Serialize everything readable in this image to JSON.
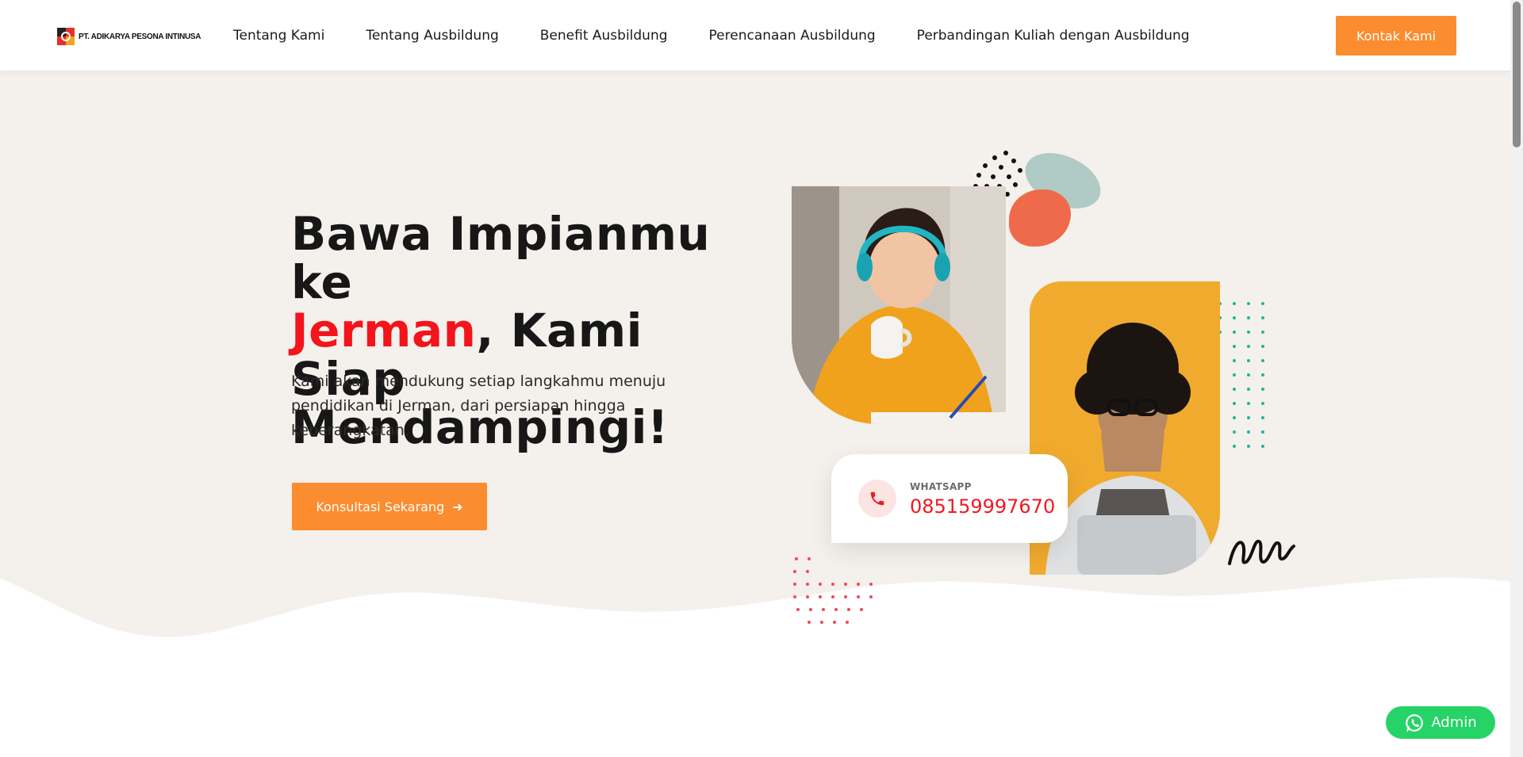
{
  "header": {
    "logo_text": "PT. ADIKARYA PESONA INTINUSA",
    "nav": [
      {
        "label": "Tentang Kami"
      },
      {
        "label": "Tentang Ausbildung"
      },
      {
        "label": "Benefit Ausbildung"
      },
      {
        "label": "Perencanaan Ausbildung"
      },
      {
        "label": "Perbandingan Kuliah dengan Ausbildung"
      }
    ],
    "contact_button": "Kontak Kami"
  },
  "hero": {
    "headline_part1": "Bawa Impianmu ke",
    "headline_highlight": "Jerman",
    "headline_part2": ", Kami Siap Mendampingi!",
    "subtext": "Kami akan mendukung setiap langkahmu menuju pendidikan di Jerman, dari persiapan hingga keberangkatan.",
    "cta_button": "Konsultasi Sekarang",
    "whatsapp_label": "WHATSAPP",
    "whatsapp_number": "085159997670"
  },
  "floating_button": {
    "label": "Admin"
  },
  "icons": [
    "phone-icon",
    "arrow-right-icon",
    "whatsapp-icon"
  ],
  "colors": {
    "accent_orange": "#fb8c2f",
    "highlight_red": "#f3141c",
    "hero_bg": "#f4f0eb",
    "whatsapp_green": "#25d366"
  }
}
